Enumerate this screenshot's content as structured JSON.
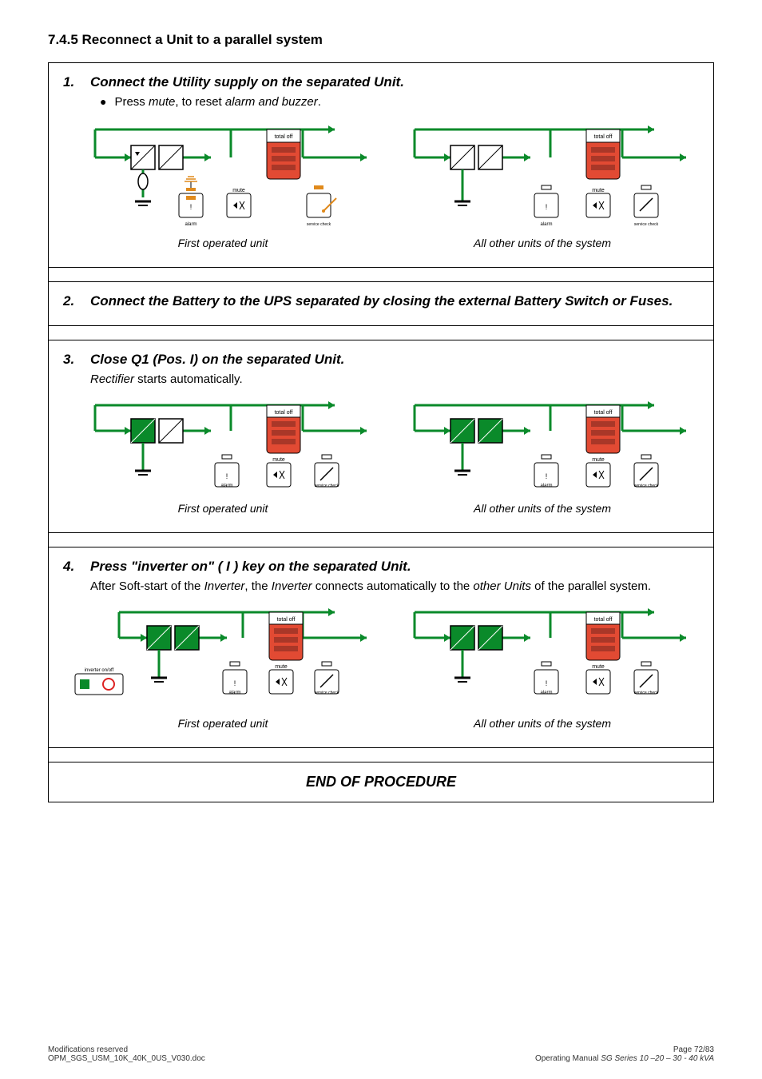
{
  "heading": "7.4.5   Reconnect a Unit to a parallel system",
  "steps": {
    "s1": {
      "num": "1.",
      "title": "Connect the Utility supply on the separated Unit.",
      "bullet_pre": "Press ",
      "bullet_mute": "mute",
      "bullet_mid": ", to reset ",
      "bullet_ab": "alarm and buzzer",
      "bullet_post": ".",
      "cap_left": "First operated unit",
      "cap_right": "All other units of the system"
    },
    "s2": {
      "num": "2.",
      "title": "Connect the Battery to the UPS separated by closing the external Battery Switch or Fuses."
    },
    "s3": {
      "num": "3.",
      "title": "Close Q1 (Pos. I) on the separated Unit.",
      "sub_pre": "",
      "sub_rect": "Rectifier",
      "sub_post": " starts automatically.",
      "cap_left": "First operated unit",
      "cap_right": "All other units of the system"
    },
    "s4": {
      "num": "4.",
      "title": "Press \"inverter on\" ( I ) key on the separated Unit.",
      "sub_pre": "After Soft-start of the ",
      "sub_i1": "Inverter",
      "sub_mid1": ", the ",
      "sub_i2": "Inverter",
      "sub_mid2": " connects automatically to the ",
      "sub_i3": "other Units",
      "sub_post": " of the parallel system.",
      "cap_left": "First operated unit",
      "cap_right": "All other units of the system"
    }
  },
  "end": "END OF PROCEDURE",
  "footer": {
    "left1": "Modifications reserved",
    "left2": "OPM_SGS_USM_10K_40K_0US_V030.doc",
    "right1": "Page 72/83",
    "right2_a": "Operating Manual ",
    "right2_b": "SG Series 10 –20 – 30 - 40 kVA"
  },
  "svg_labels": {
    "total_off": "total off",
    "mute": "mute",
    "alarm": "alarm",
    "service": "service check",
    "inverter": "inverter on/off"
  }
}
